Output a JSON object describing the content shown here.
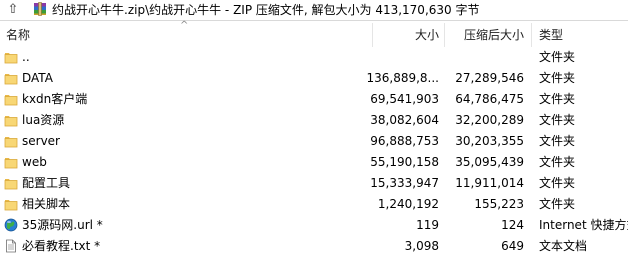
{
  "address": {
    "up_icon": "up-arrow-icon",
    "archive_icon": "rar-archive-icon",
    "path": "约战开心牛牛.zip\\约战开心牛牛 - ZIP 压缩文件, 解包大小为 413,170,630 字节"
  },
  "columns": {
    "name": "名称",
    "size": "大小",
    "packed": "压缩后大小",
    "type": "类型"
  },
  "files": [
    {
      "name": "..",
      "size": "",
      "packed": "",
      "type": "文件夹",
      "icon": "folder-icon"
    },
    {
      "name": "DATA",
      "size": "136,889,8...",
      "packed": "27,289,546",
      "type": "文件夹",
      "icon": "folder-icon"
    },
    {
      "name": "kxdn客户端",
      "size": "69,541,903",
      "packed": "64,786,475",
      "type": "文件夹",
      "icon": "folder-icon"
    },
    {
      "name": "lua资源",
      "size": "38,082,604",
      "packed": "32,200,289",
      "type": "文件夹",
      "icon": "folder-icon"
    },
    {
      "name": "server",
      "size": "96,888,753",
      "packed": "30,203,355",
      "type": "文件夹",
      "icon": "folder-icon"
    },
    {
      "name": "web",
      "size": "55,190,158",
      "packed": "35,095,439",
      "type": "文件夹",
      "icon": "folder-icon"
    },
    {
      "name": "配置工具",
      "size": "15,333,947",
      "packed": "11,911,014",
      "type": "文件夹",
      "icon": "folder-icon"
    },
    {
      "name": "相关脚本",
      "size": "1,240,192",
      "packed": "155,223",
      "type": "文件夹",
      "icon": "folder-icon"
    },
    {
      "name": "35源码网.url *",
      "size": "119",
      "packed": "124",
      "type": "Internet 快捷方式",
      "icon": "internet-shortcut-icon"
    },
    {
      "name": "必看教程.txt *",
      "size": "3,098",
      "packed": "649",
      "type": "文本文档",
      "icon": "text-file-icon"
    }
  ]
}
